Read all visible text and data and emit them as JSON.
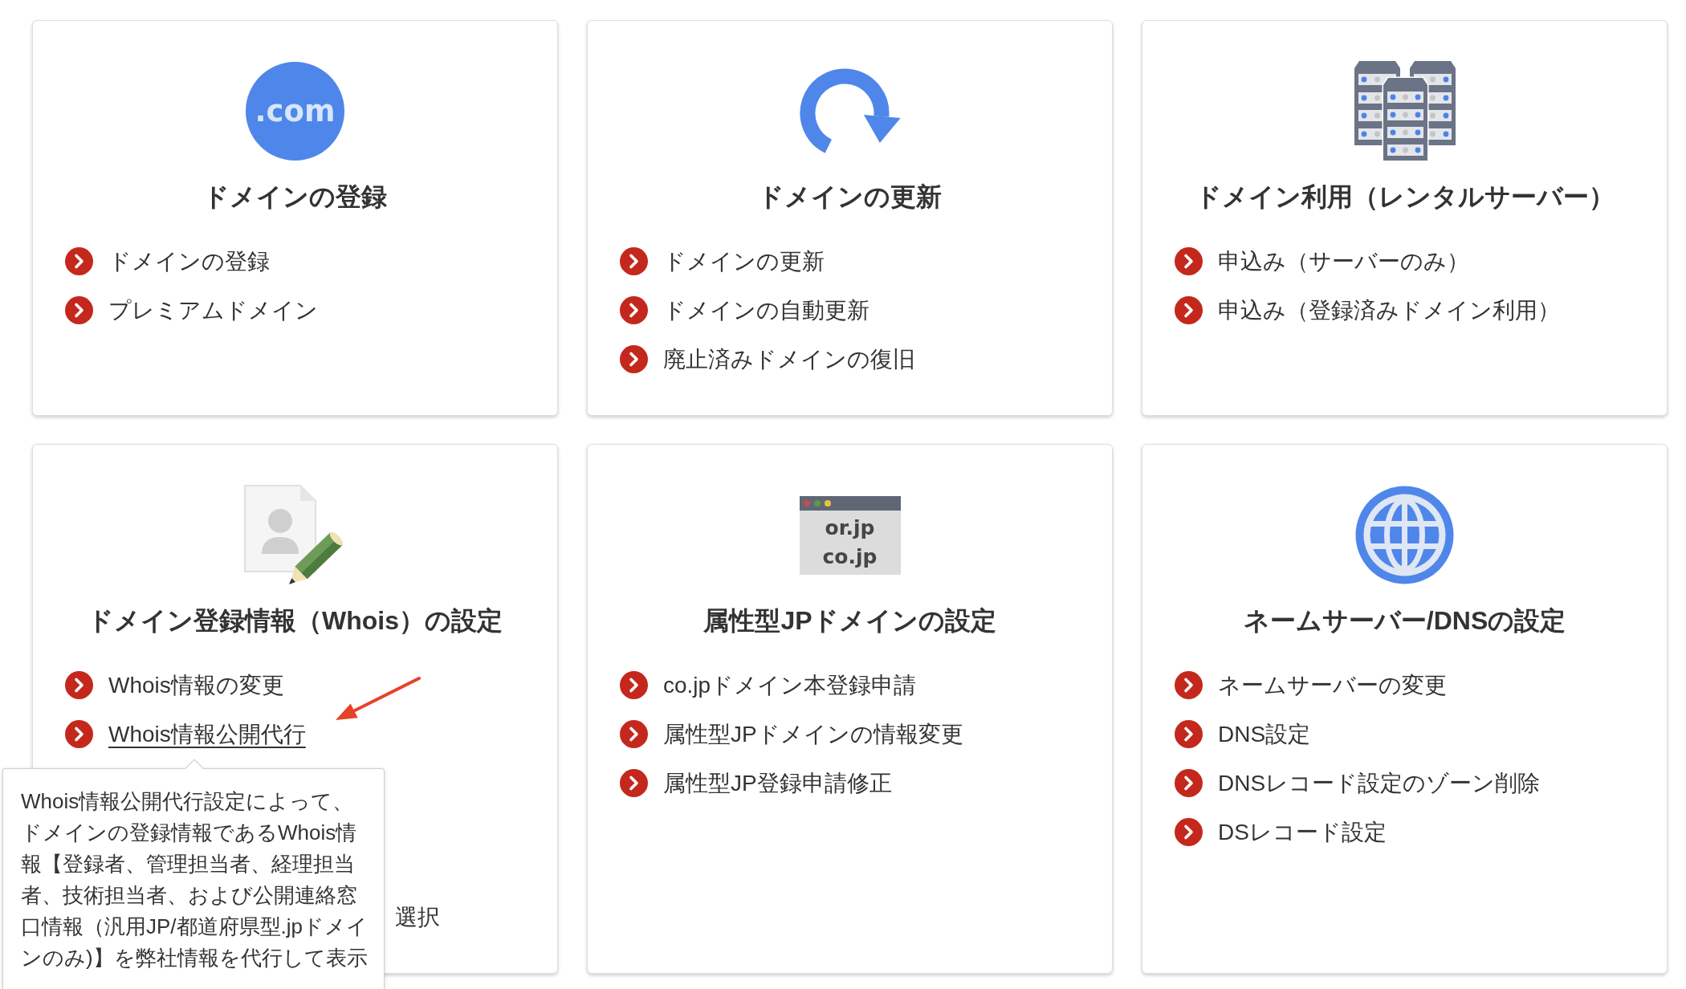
{
  "cards": [
    {
      "icon": {
        "kind": "dotcom",
        "label": ".com"
      },
      "title": "ドメインの登録",
      "items": [
        {
          "text": "ドメインの登録",
          "hovered": false
        },
        {
          "text": "プレミアムドメイン",
          "hovered": false
        }
      ]
    },
    {
      "icon": {
        "kind": "renew"
      },
      "title": "ドメインの更新",
      "items": [
        {
          "text": "ドメインの更新",
          "hovered": false
        },
        {
          "text": "ドメインの自動更新",
          "hovered": false
        },
        {
          "text": "廃止済みドメインの復旧",
          "hovered": false
        }
      ]
    },
    {
      "icon": {
        "kind": "servers"
      },
      "title": "ドメイン利用（レンタルサーバー）",
      "items": [
        {
          "text": "申込み（サーバーのみ）",
          "hovered": false
        },
        {
          "text": "申込み（登録済みドメイン利用）",
          "hovered": false
        }
      ]
    },
    {
      "icon": {
        "kind": "profile-edit"
      },
      "title": "ドメイン登録情報（Whois）の設定",
      "items": [
        {
          "kind": "link",
          "text": "Whois情報の変更",
          "hovered": false
        },
        {
          "kind": "link",
          "text": "Whois情報公開代行",
          "hovered": true
        },
        {
          "kind": "covered",
          "text": "選択",
          "hovered": false
        }
      ]
    },
    {
      "icon": {
        "kind": "browser",
        "labels": [
          "or.jp",
          "co.jp"
        ]
      },
      "title": "属性型JPドメインの設定",
      "items": [
        {
          "text": "co.jpドメイン本登録申請",
          "hovered": false
        },
        {
          "text": "属性型JPドメインの情報変更",
          "hovered": false
        },
        {
          "text": "属性型JP登録申請修正",
          "hovered": false
        }
      ]
    },
    {
      "icon": {
        "kind": "globe"
      },
      "title": "ネームサーバー/DNSの設定",
      "items": [
        {
          "text": "ネームサーバーの変更",
          "hovered": false
        },
        {
          "text": "DNS設定",
          "hovered": false
        },
        {
          "text": "DNSレコード設定のゾーン削除",
          "hovered": false
        },
        {
          "text": "DSレコード設定",
          "hovered": false
        }
      ]
    }
  ],
  "tooltip": {
    "paragraphs": [
      "Whois情報公開代行設定によって、",
      "ドメインの登録情報であるWhois情報【登録者、管理担当者、経理担当者、技術担当者、および公開連絡窓口情報（汎用JP/都道府県型.jpドメインのみ)】を弊社情報を代行して表示"
    ]
  }
}
